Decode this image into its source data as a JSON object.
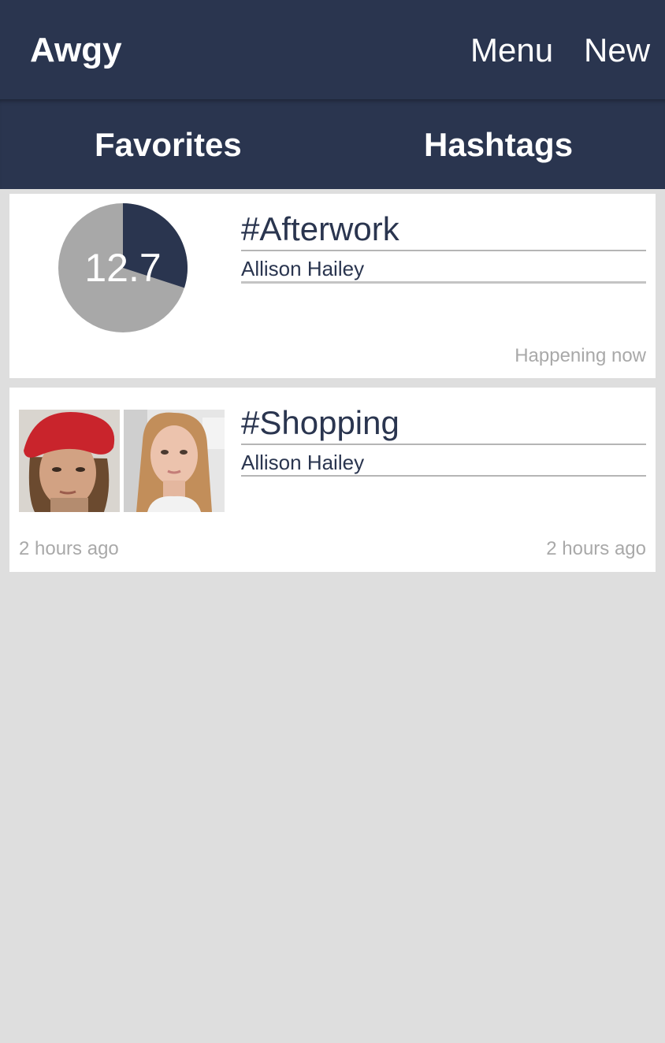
{
  "header": {
    "app_title": "Awgy",
    "menu_label": "Menu",
    "new_label": "New"
  },
  "tabs": [
    {
      "label": "Favorites"
    },
    {
      "label": "Hashtags"
    }
  ],
  "feed": [
    {
      "hashtag": "#Afterwork",
      "author": "Allison Hailey",
      "status": "Happening now",
      "countdown": {
        "value_label": "12.7",
        "elapsed_fraction": 0.3,
        "colors": {
          "filled": "#2a354f",
          "remaining": "#a8a8a8"
        }
      }
    },
    {
      "hashtag": "#Shopping",
      "author": "Allison Hailey",
      "time_left": "2 hours ago",
      "time_right": "2 hours ago",
      "photos": [
        "woman-red-beret-photo",
        "woman-blonde-hair-photo"
      ]
    }
  ],
  "colors": {
    "navbar": "#2a354f",
    "background": "#dedede",
    "card": "#ffffff",
    "muted_text": "#a9a9a9"
  }
}
